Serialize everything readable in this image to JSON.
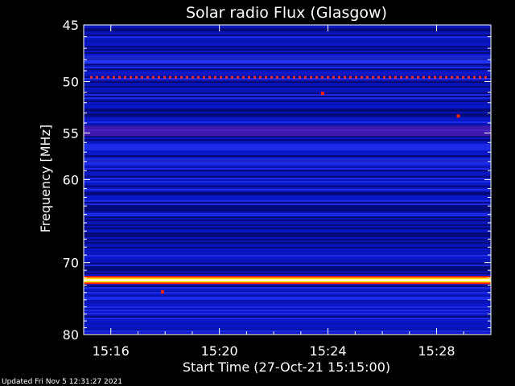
{
  "chart_data": {
    "type": "heatmap",
    "title": "Solar radio Flux (Glasgow)",
    "xlabel": "Start Time (27-Oct-21 15:15:00)",
    "ylabel": "Frequency [MHz]",
    "x_range_minutes": [
      15.0,
      30.0
    ],
    "x_ticks": [
      "15:16",
      "15:20",
      "15:24",
      "15:28"
    ],
    "x_tick_minutes": [
      16,
      20,
      24,
      28
    ],
    "y_range": [
      45,
      80
    ],
    "y_ticks": [
      45,
      50,
      55,
      60,
      70,
      80
    ],
    "y_scale": "log",
    "features": [
      {
        "kind": "strong-band",
        "freq_mhz": 72.3,
        "level": 1.0
      },
      {
        "kind": "dotted-band",
        "freq_mhz": 49.6,
        "level": 0.6
      },
      {
        "kind": "band",
        "freq_mhz": 54.8,
        "level": 0.45
      },
      {
        "kind": "band",
        "freq_mhz": 48.0,
        "level": 0.3
      },
      {
        "kind": "band",
        "freq_mhz": 58.0,
        "level": 0.25
      },
      {
        "kind": "spot",
        "freq_mhz": 51.1,
        "time_min": 23.8
      },
      {
        "kind": "spot",
        "freq_mhz": 53.3,
        "time_min": 28.8
      },
      {
        "kind": "spot",
        "freq_mhz": 73.9,
        "time_min": 17.9
      }
    ],
    "colormap": [
      "#00003a",
      "#0a18c8",
      "#2a3cff",
      "#c0203a",
      "#ff2000",
      "#ffe000",
      "#ffffff"
    ],
    "background_color": "#000000"
  },
  "footer": {
    "updated_text": "Updated Fri Nov  5 12:31:27 2021"
  }
}
